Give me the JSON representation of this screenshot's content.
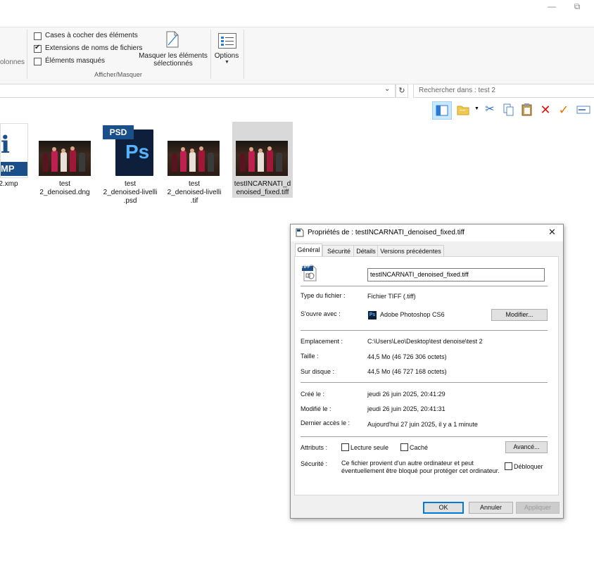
{
  "window": {
    "minimize_glyph": "—",
    "restore_glyph": "⧉"
  },
  "ribbon": {
    "columns_partial": "olonnes",
    "checkbox_cases": "Cases à cocher des éléments",
    "checkbox_extensions": "Extensions de noms de fichiers",
    "checkbox_hidden": "Éléments masqués",
    "hide_selected_line1": "Masquer les éléments",
    "hide_selected_line2": "sélectionnés",
    "options_label": "Options",
    "group_label": "Afficher/Masquer",
    "extensions_checked": true,
    "cases_checked": false,
    "hidden_checked": false
  },
  "address": {
    "search_placeholder": "Rechercher dans : test 2"
  },
  "files": [
    {
      "line1": "2.xmp",
      "line2": "",
      "line3": "",
      "icon_text": "MP"
    },
    {
      "line1": "test",
      "line2": "2_denoised.dng",
      "line3": ""
    },
    {
      "line1": "test",
      "line2": "2_denoised-livelli",
      "line3": ".psd",
      "icon_text": "Ps",
      "badge": "PSD"
    },
    {
      "line1": "test",
      "line2": "2_denoised-livelli",
      "line3": ".tif"
    },
    {
      "line1": "testINCARNATI_d",
      "line2": "enoised_fixed.tiff",
      "line3": ""
    }
  ],
  "dialog": {
    "title": "Propriétés de : testINCARNATI_denoised_fixed.tiff",
    "close_glyph": "✕",
    "tabs": [
      "Général",
      "Sécurité",
      "Détails",
      "Versions précédentes"
    ],
    "file_icon_text": "TIFF",
    "filename_value": "testINCARNATI_denoised_fixed.tiff",
    "type_label": "Type du fichier :",
    "type_value": "Fichier TIFF (.tiff)",
    "opens_label": "S'ouvre avec :",
    "opens_value": "Adobe Photoshop CS6",
    "opens_icon_text": "Ps",
    "modify_button": "Modifier...",
    "location_label": "Emplacement :",
    "location_value": "C:\\Users\\Leo\\Desktop\\test denoise\\test 2",
    "size_label": "Taille :",
    "size_value": "44,5 Mo (46 726 306 octets)",
    "disk_label": "Sur disque :",
    "disk_value": "44,5 Mo (46 727 168 octets)",
    "created_label": "Créé le :",
    "created_value": "jeudi 26 juin 2025, 20:41:29",
    "modified_label": "Modifié le :",
    "modified_value": "jeudi 26 juin 2025, 20:41:31",
    "accessed_label": "Dernier accès le :",
    "accessed_value": "Aujourd'hui 27 juin 2025, il y a 1 minute",
    "attributes_label": "Attributs :",
    "readonly_label": "Lecture seule",
    "hidden_label": "Caché",
    "advanced_button": "Avancé...",
    "security_label": "Sécurité :",
    "security_text_line1": "Ce fichier provient d'un autre ordinateur et peut",
    "security_text_line2": "éventuellement être bloqué pour protéger cet ordinateur.",
    "unblock_label": "Débloquer",
    "ok_button": "OK",
    "cancel_button": "Annuler",
    "apply_button": "Appliquer"
  }
}
